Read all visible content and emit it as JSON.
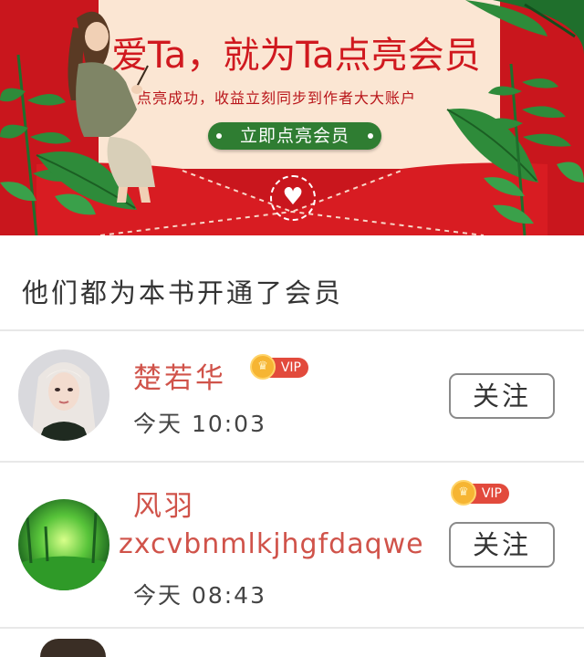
{
  "banner": {
    "title": "爱Ta，就为Ta点亮会员",
    "subtitle": "点亮成功，收益立刻同步到作者大大账户",
    "cta_label": "立即点亮会员"
  },
  "section": {
    "title": "他们都为本书开通了会员"
  },
  "members": [
    {
      "name": "楚若华",
      "badge": "VIP",
      "extra": "",
      "time": "今天 10:03",
      "follow_label": "关注",
      "avatar": "woman-with-blonde-hair-photo"
    },
    {
      "name": "风羽",
      "badge": "VIP",
      "extra": "zxcvbnmlkjhgfdaqwe",
      "time": "今天 08:43",
      "follow_label": "关注",
      "avatar": "green-forest-photo"
    }
  ],
  "colors": {
    "banner_red": "#c9161d",
    "cta_green": "#2f7d32",
    "name_red": "#d0534a",
    "vip_red": "#e24a3c",
    "crown_gold": "#f6b533"
  }
}
